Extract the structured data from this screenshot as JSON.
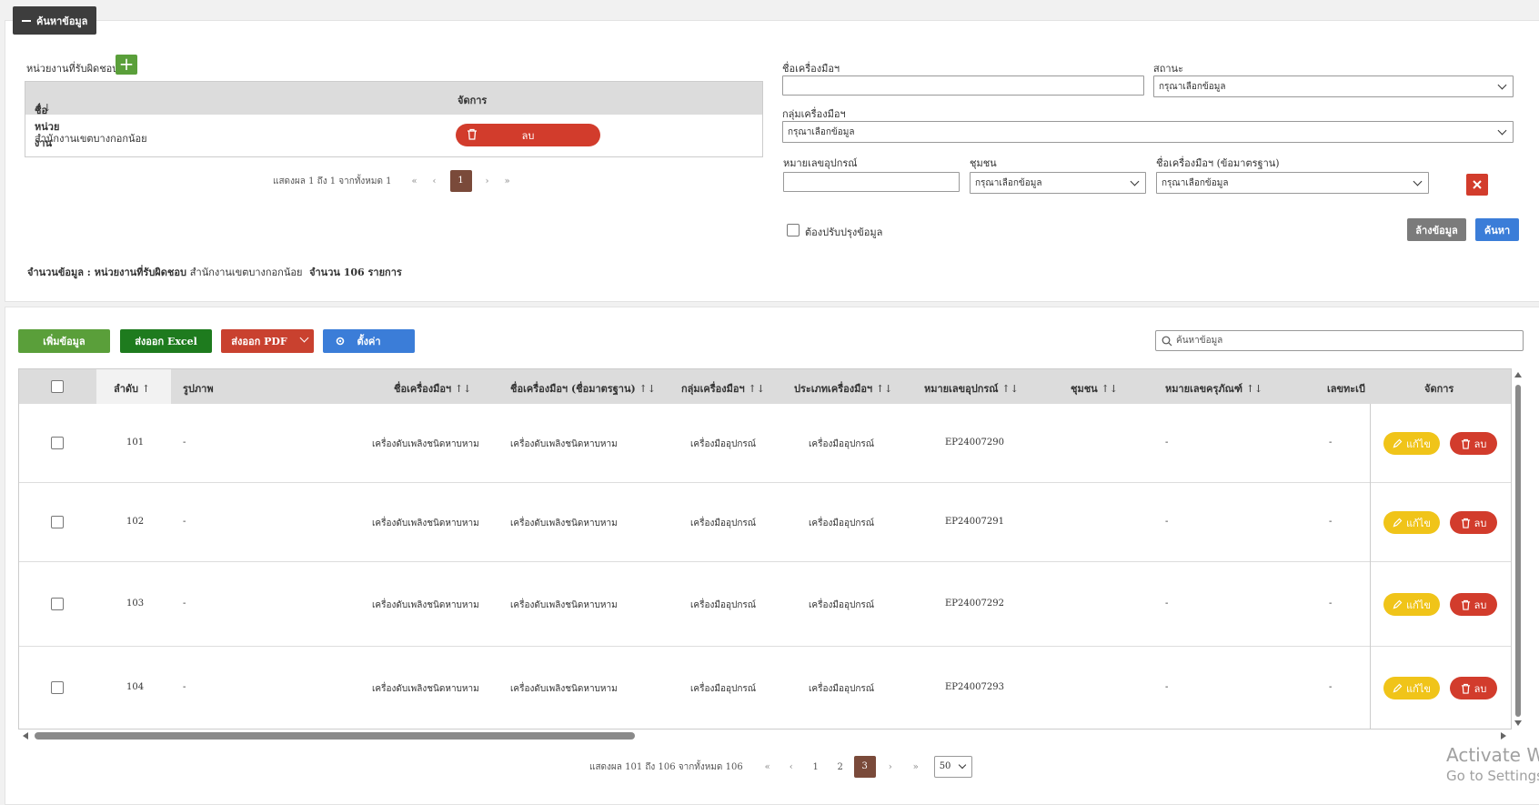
{
  "search_panel": {
    "toggle_label": "ค้นหาข้อมูล",
    "responsible_label": "หน่วยงานที่รับผิดชอบ",
    "resp_table": {
      "col_name": "ชื่อหน่วยงาน",
      "col_manage": "จัดการ",
      "row_name": "สำนักงานเขตบางกอกน้อย",
      "delete_label": "ลบ"
    },
    "resp_pager": {
      "info": "แสดงผล 1 ถึง 1 จากทั้งหมด 1",
      "first": "«",
      "prev": "‹",
      "page": "1",
      "next": "›",
      "last": "»"
    },
    "tool_name_label": "ชื่อเครื่องมือฯ",
    "status_label": "สถานะ",
    "status_placeholder": "กรุณาเลือกข้อมูล",
    "group_label": "กลุ่มเครื่องมือฯ",
    "group_placeholder": "กรุณาเลือกข้อมูล",
    "device_no_label": "หมายเลขอุปกรณ์",
    "community_label": "ชุมชน",
    "community_placeholder": "กรุณาเลือกข้อมูล",
    "std_name_label": "ชื่อเครื่องมือฯ (ข้อมาตรฐาน)",
    "std_name_placeholder": "กรุณาเลือกข้อมูล",
    "update_needed_label": "ต้องปรับปรุงข้อมูล",
    "clear_label": "ล้างข้อมูล",
    "search_label": "ค้นหา",
    "summary": {
      "prefix": "จำนวนข้อมูล :",
      "resp_label": "หน่วยงานที่รับผิดชอบ",
      "resp_value": "สำนักงานเขตบางกอกน้อย",
      "count": "จำนวน 106 รายการ"
    }
  },
  "toolbar": {
    "add_label": "เพิ่มข้อมูล",
    "excel_label": "ส่งออก Excel",
    "pdf_label": "ส่งออก PDF",
    "settings_label": "ตั้งค่า",
    "search_placeholder": "ค้นหาข้อมูล"
  },
  "table": {
    "headers": {
      "seq": "ลำดับ",
      "image": "รูปภาพ",
      "tool_name": "ชื่อเครื่องมือฯ",
      "std_name": "ชื่อเครื่องมือฯ (ชื่อมาตรฐาน)",
      "group": "กลุ่มเครื่องมือฯ",
      "type": "ประเภทเครื่องมือฯ",
      "device_no": "หมายเลขอุปกรณ์",
      "community": "ชุมชน",
      "asset_no": "หมายเลขครุภัณฑ์",
      "reg_no": "เลขทะเบี",
      "manage": "จัดการ"
    },
    "rows": [
      {
        "seq": "101",
        "image": "-",
        "tool_name": "เครื่องดับเพลิงชนิดหาบหาม",
        "std_name": "เครื่องดับเพลิงชนิดหาบหาม",
        "group": "เครื่องมืออุปกรณ์",
        "type": "เครื่องมืออุปกรณ์",
        "device_no": "EP24007290",
        "community": "",
        "asset_no": "-",
        "reg_no": "-"
      },
      {
        "seq": "102",
        "image": "-",
        "tool_name": "เครื่องดับเพลิงชนิดหาบหาม",
        "std_name": "เครื่องดับเพลิงชนิดหาบหาม",
        "group": "เครื่องมืออุปกรณ์",
        "type": "เครื่องมืออุปกรณ์",
        "device_no": "EP24007291",
        "community": "",
        "asset_no": "-",
        "reg_no": "-"
      },
      {
        "seq": "103",
        "image": "-",
        "tool_name": "เครื่องดับเพลิงชนิดหาบหาม",
        "std_name": "เครื่องดับเพลิงชนิดหาบหาม",
        "group": "เครื่องมืออุปกรณ์",
        "type": "เครื่องมืออุปกรณ์",
        "device_no": "EP24007292",
        "community": "",
        "asset_no": "-",
        "reg_no": "-"
      },
      {
        "seq": "104",
        "image": "-",
        "tool_name": "เครื่องดับเพลิงชนิดหาบหาม",
        "std_name": "เครื่องดับเพลิงชนิดหาบหาม",
        "group": "เครื่องมืออุปกรณ์",
        "type": "เครื่องมืออุปกรณ์",
        "device_no": "EP24007293",
        "community": "",
        "asset_no": "-",
        "reg_no": "-"
      }
    ],
    "edit_label": "แก้ไข",
    "delete_label": "ลบ"
  },
  "pager": {
    "info": "แสดงผล 101 ถึง 106 จากทั้งหมด 106",
    "first": "«",
    "prev": "‹",
    "pages": [
      "1",
      "2",
      "3"
    ],
    "next": "›",
    "last": "»",
    "page_size": "50"
  },
  "watermark": {
    "line1": "Activate Wi",
    "line2": "Go to Settings t"
  }
}
